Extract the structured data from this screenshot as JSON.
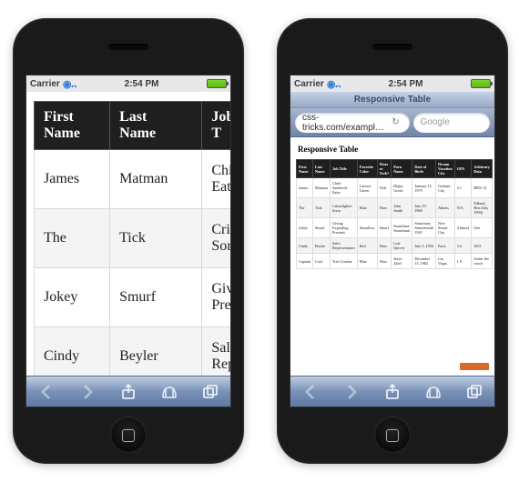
{
  "status": {
    "carrier": "Carrier",
    "time": "2:54 PM"
  },
  "left": {
    "headers": [
      "First Name",
      "Last Name",
      "Job T"
    ],
    "rows": [
      [
        "James",
        "Matman",
        "Chief S\nEater"
      ],
      [
        "The",
        "Tick",
        "Crimef\nSorta"
      ],
      [
        "Jokey",
        "Smurf",
        "Giving\nPresen"
      ],
      [
        "Cindy",
        "Beyler",
        "Sales\nRepres"
      ]
    ]
  },
  "right": {
    "page_title_bar": "Responsive Table",
    "url": "css-tricks.com/exampl…",
    "search_placeholder": "Google",
    "heading": "Responsive Table",
    "headers": [
      "First Name",
      "Last Name",
      "Job Title",
      "Favorite Color",
      "Wars or Trek?",
      "Porn Name",
      "Date of Birth",
      "Dream Vacation City",
      "GPA",
      "Arbitrary Data"
    ],
    "rows": [
      [
        "James",
        "Matman",
        "Chief Sandwich Eater",
        "Lettuce Green",
        "Trek",
        "Digby Green",
        "January 13, 1979",
        "Gotham City",
        "3.1",
        "RBX-12"
      ],
      [
        "The",
        "Tick",
        "Crimefighter Sorta",
        "Blue",
        "Wars",
        "John Smith",
        "July 19, 1968",
        "Athens",
        "N/A",
        "Edlund, Ben (July 1996)"
      ],
      [
        "Jokey",
        "Smurf",
        "Giving Exploding Presents",
        "Smurflow",
        "Smurf",
        "Smurflane Smurfmutt",
        "Smurfuary Smurfteenth 1945",
        "New Smurf City",
        "4.Smurf",
        "One"
      ],
      [
        "Cindy",
        "Beyler",
        "Sales Representative",
        "Red",
        "Wars",
        "Lori Quivey",
        "July 5, 1956",
        "Paris",
        "3.4",
        "3451"
      ],
      [
        "Captain",
        "Cool",
        "Tree Crusher",
        "Blue",
        "Wars",
        "Steve 42nd",
        "December 13, 1982",
        "Las Vegas",
        "1.9",
        "Under the couch"
      ]
    ]
  },
  "toolbar_icons": [
    "back",
    "forward",
    "share",
    "bookmarks",
    "tabs"
  ]
}
